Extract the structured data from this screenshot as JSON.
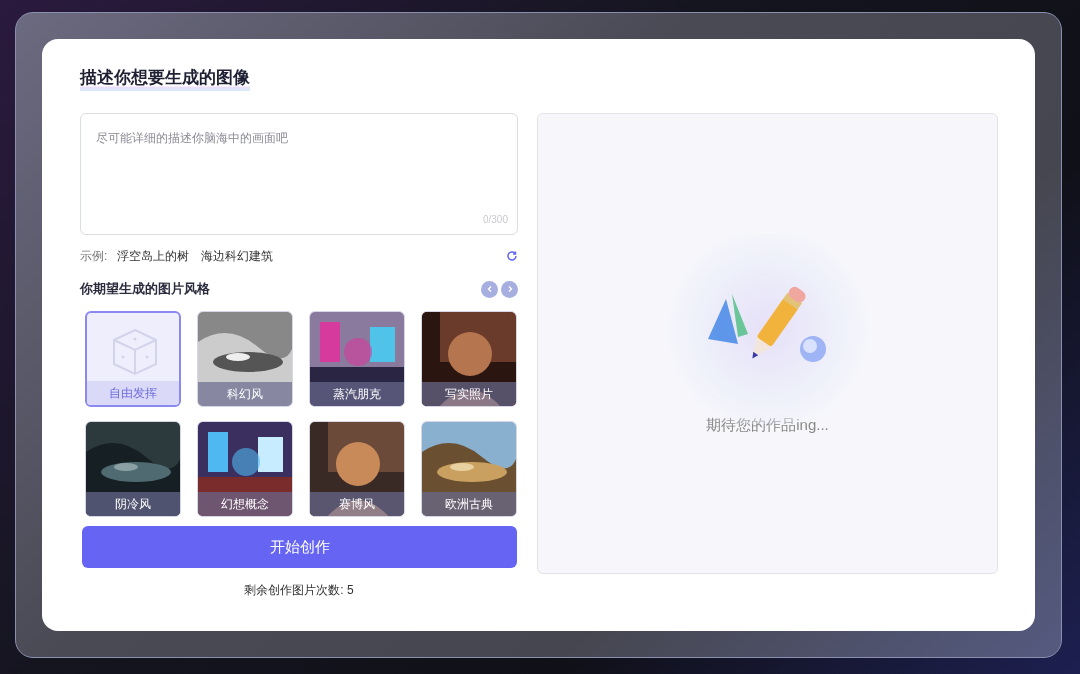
{
  "title": "描述你想要生成的图像",
  "prompt": {
    "placeholder": "尽可能详细的描述你脑海中的画面吧",
    "counter": "0/300"
  },
  "examples": {
    "label": "示例:",
    "items": [
      "浮空岛上的树",
      "海边科幻建筑"
    ]
  },
  "styles_heading": "你期望生成的图片风格",
  "styles": [
    {
      "label": "自由发挥",
      "selected": true,
      "kind": "random"
    },
    {
      "label": "科幻风",
      "selected": false,
      "kind": "picture"
    },
    {
      "label": "蒸汽朋克",
      "selected": false,
      "kind": "picture"
    },
    {
      "label": "写实照片",
      "selected": false,
      "kind": "picture"
    },
    {
      "label": "阴冷风",
      "selected": false,
      "kind": "picture"
    },
    {
      "label": "幻想概念",
      "selected": false,
      "kind": "picture"
    },
    {
      "label": "赛博风",
      "selected": false,
      "kind": "picture"
    },
    {
      "label": "欧洲古典",
      "selected": false,
      "kind": "picture"
    }
  ],
  "create_button": "开始创作",
  "remaining": "剩余创作图片次数: 5",
  "preview": {
    "message": "期待您的作品ing..."
  }
}
